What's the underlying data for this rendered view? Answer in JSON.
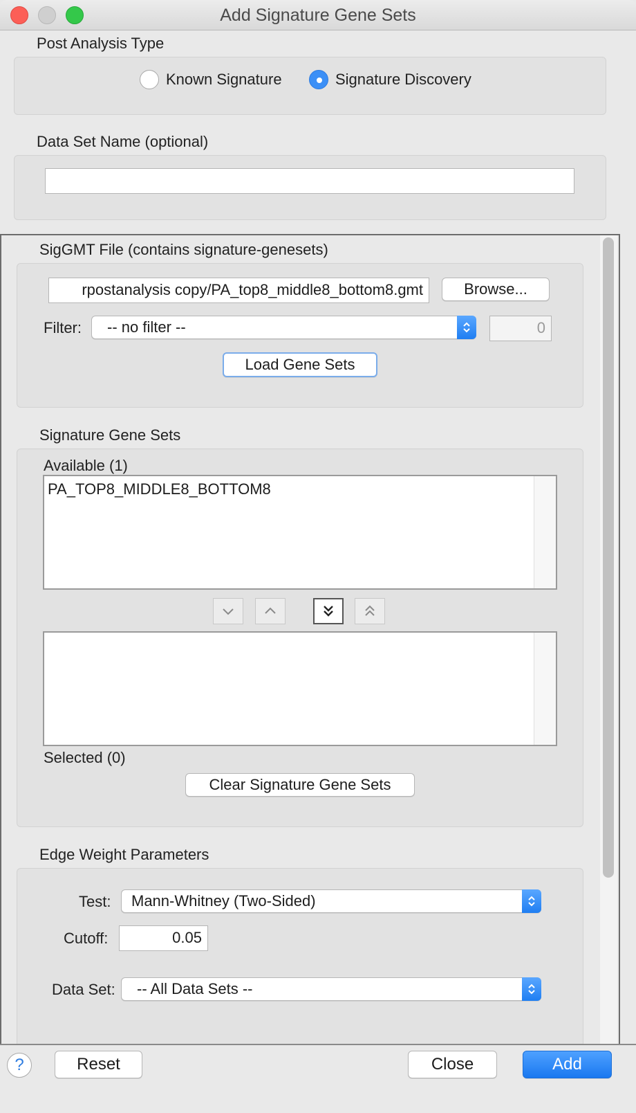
{
  "window": {
    "title": "Add Signature Gene Sets"
  },
  "post_analysis": {
    "label": "Post Analysis Type",
    "options": [
      "Known Signature",
      "Signature Discovery"
    ],
    "selected": "Signature Discovery"
  },
  "dataset_name": {
    "label": "Data Set Name (optional)",
    "value": ""
  },
  "siggmt": {
    "label": "SigGMT File (contains signature-genesets)",
    "file_path": "rpostanalysis copy/PA_top8_middle8_bottom8.gmt",
    "browse_label": "Browse...",
    "filter_label": "Filter:",
    "filter_value": "-- no filter --",
    "filter_count": "0",
    "load_label": "Load Gene Sets"
  },
  "signature_sets": {
    "label": "Signature Gene Sets",
    "available_label": "Available (1)",
    "available_items": [
      "PA_TOP8_MIDDLE8_BOTTOM8"
    ],
    "selected_label": "Selected (0)",
    "selected_items": [],
    "clear_label": "Clear Signature Gene Sets"
  },
  "edge_weight": {
    "label": "Edge Weight Parameters",
    "test_label": "Test:",
    "test_value": "Mann-Whitney (Two-Sided)",
    "cutoff_label": "Cutoff:",
    "cutoff_value": "0.05",
    "dataset_label": "Data Set:",
    "dataset_value": "-- All Data Sets --"
  },
  "footer": {
    "help_label": "?",
    "reset_label": "Reset",
    "close_label": "Close",
    "add_label": "Add"
  },
  "colors": {
    "accent": "#1a78f0",
    "close_light": "#fc5f57",
    "max_light": "#34c84a"
  }
}
